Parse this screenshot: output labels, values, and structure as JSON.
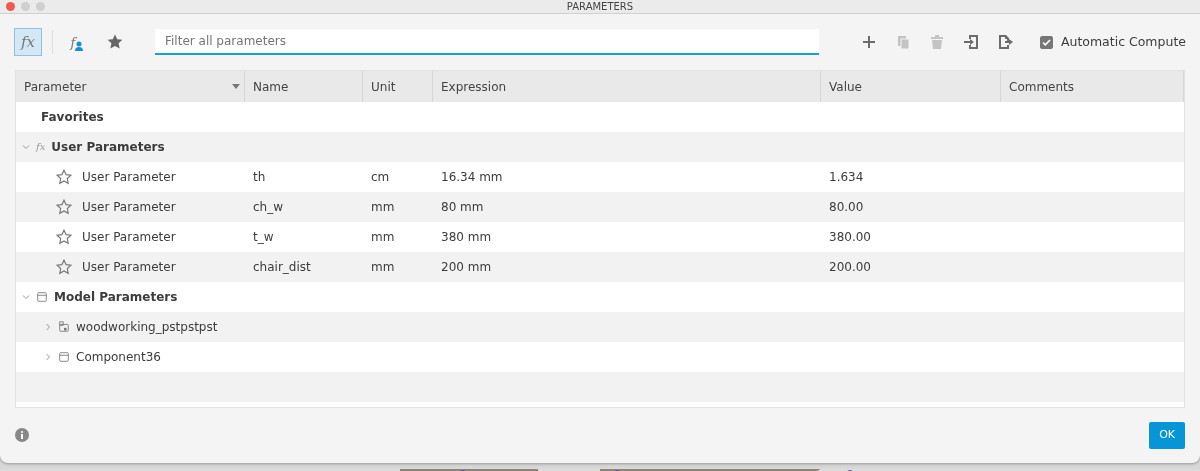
{
  "window": {
    "title": "PARAMETERS"
  },
  "toolbar": {
    "views": [
      {
        "kind": "all",
        "label": "fx",
        "selected": true
      },
      {
        "kind": "user",
        "label": "f",
        "selected": false
      },
      {
        "kind": "favorites",
        "selected": false
      }
    ],
    "search": {
      "placeholder": "Filter all parameters"
    },
    "actions": [
      {
        "kind": "add",
        "disabled": false
      },
      {
        "kind": "copy",
        "disabled": true
      },
      {
        "kind": "delete",
        "disabled": true
      },
      {
        "kind": "import",
        "disabled": false
      },
      {
        "kind": "export",
        "disabled": false
      }
    ],
    "automatic_compute": {
      "label": "Automatic Compute",
      "checked": true
    }
  },
  "table": {
    "columns": [
      "Parameter",
      "Name",
      "Unit",
      "Expression",
      "Value",
      "Comments"
    ],
    "rows": [
      {
        "kind": "favorites",
        "label": "Favorites"
      },
      {
        "kind": "user_group",
        "icon_text": "fx",
        "label": "User Parameters",
        "expanded": true,
        "children": [
          {
            "kind": "parameter",
            "favorite": false,
            "label": "User Parameter",
            "name": "th",
            "unit": "cm",
            "expression": "16.34 mm",
            "value": "1.634"
          },
          {
            "kind": "parameter",
            "favorite": false,
            "label": "User Parameter",
            "name": "ch_w",
            "unit": "mm",
            "expression": "80 mm",
            "value": "80.00"
          },
          {
            "kind": "parameter",
            "favorite": false,
            "label": "User Parameter",
            "name": "t_w",
            "unit": "mm",
            "expression": "380 mm",
            "value": "380.00"
          },
          {
            "kind": "parameter",
            "favorite": false,
            "label": "User Parameter",
            "name": "chair_dist",
            "unit": "mm",
            "expression": "200 mm",
            "value": "200.00"
          }
        ]
      },
      {
        "kind": "model_group",
        "label": "Model Parameters",
        "expanded": true,
        "children": [
          {
            "kind": "assembly",
            "label": "woodworking_pstpstpst",
            "expanded": false
          },
          {
            "kind": "component",
            "label": "Component36",
            "expanded": false
          }
        ]
      }
    ]
  },
  "footer": {
    "ok_button": "OK"
  }
}
